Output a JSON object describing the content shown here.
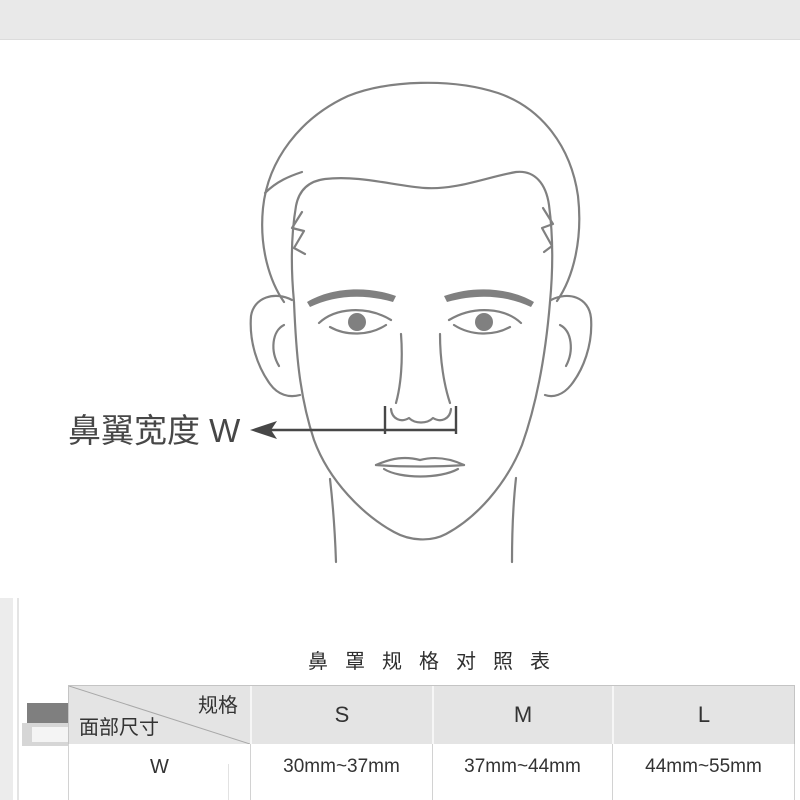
{
  "diagram": {
    "measurement_label": "鼻翼宽度 W"
  },
  "table": {
    "title": "鼻罩规格对照表",
    "corner_header": {
      "spec_label": "规格",
      "dimension_label": "面部尺寸"
    },
    "columns": [
      "S",
      "M",
      "L"
    ],
    "rows": [
      {
        "label": "W",
        "values": [
          "30mm~37mm",
          "37mm~44mm",
          "44mm~55mm"
        ]
      }
    ]
  },
  "icons": {
    "measurement_pointer": "arrow-left-icon",
    "illustration": "face-line-drawing"
  },
  "colors": {
    "background": "#ffffff",
    "band": "#e9e9e9",
    "line_art": "#808080",
    "annotation": "#474747",
    "header_bg": "#e4e4e4",
    "border": "#d2d2d2",
    "text": "#333333"
  }
}
